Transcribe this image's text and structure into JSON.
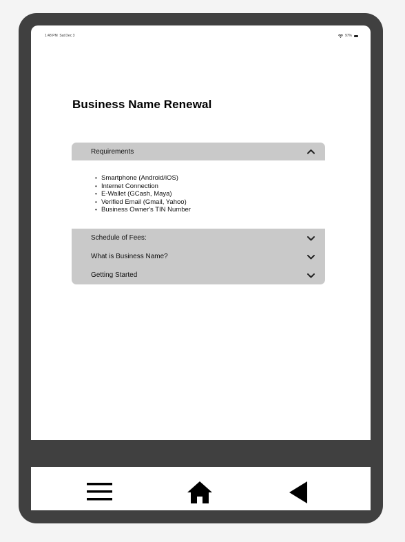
{
  "status_bar": {
    "time": "1:48 PM",
    "date": "Sat Dec 3",
    "battery": "97%"
  },
  "page": {
    "title": "Business Name Renewal"
  },
  "accordion": {
    "sections": [
      {
        "label": "Requirements",
        "expanded": true,
        "items": [
          "Smartphone (Android/iOS)",
          "Internet Connection",
          "E-Wallet (GCash, Maya)",
          "Verified Email (Gmail, Yahoo)",
          "Business Owner's TIN Number"
        ]
      },
      {
        "label": "Schedule of Fees:",
        "expanded": false
      },
      {
        "label": "What is Business Name?",
        "expanded": false
      },
      {
        "label": "Getting Started",
        "expanded": false
      }
    ]
  },
  "nav": {
    "menu_icon": "hamburger-icon",
    "home_icon": "home-icon",
    "back_icon": "back-triangle-icon"
  },
  "colors": {
    "frame": "#404040",
    "accordion": "#c9c9c9",
    "screen": "#ffffff"
  }
}
